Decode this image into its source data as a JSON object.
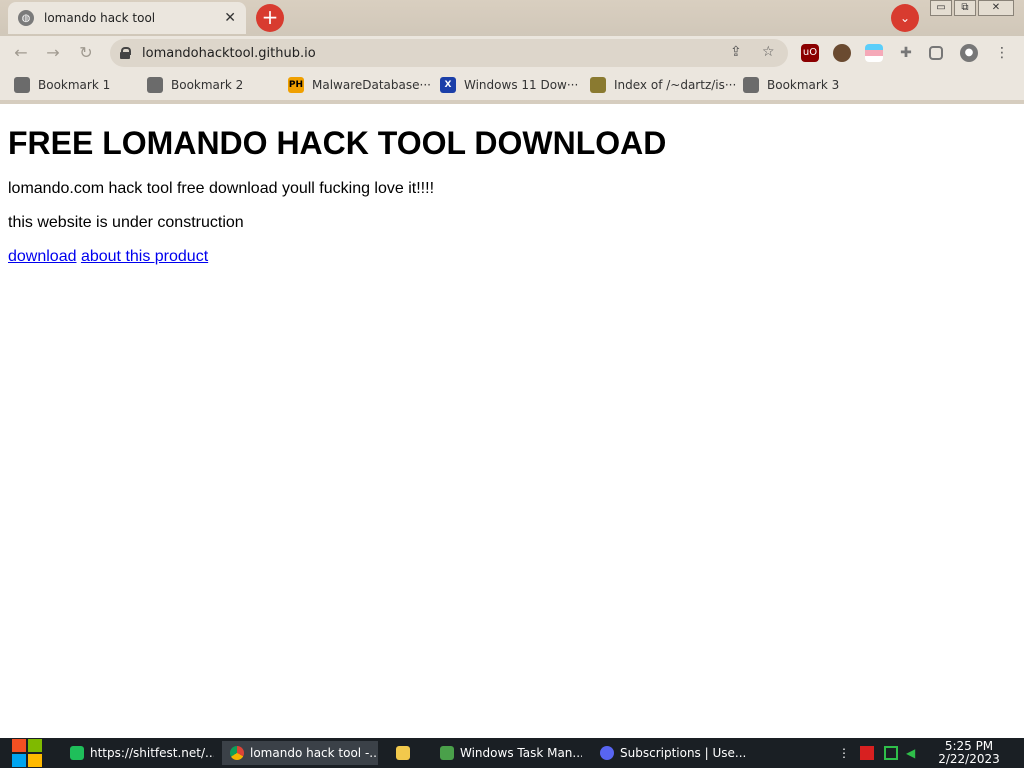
{
  "browser": {
    "tab": {
      "title": "lomando hack tool",
      "close_glyph": "✕"
    },
    "new_tab_glyph": "+",
    "tab_search_glyph": "⌄",
    "window_controls": [
      "▭",
      "⧉",
      "✕"
    ],
    "address": "lomandohacktool.github.io",
    "bookmarks": [
      {
        "label": "Bookmark 1",
        "icon": "placeholder-icon",
        "color": "#6b6b6b"
      },
      {
        "label": "Bookmark 2",
        "icon": "placeholder-icon",
        "color": "#6b6b6b"
      },
      {
        "label": "MalwareDatabase···",
        "icon": "ph-icon",
        "color": "#f0a000",
        "icon_text": "PH"
      },
      {
        "label": "Windows 11 Dow···",
        "icon": "x-icon",
        "color": "#1b3fa8",
        "icon_text": "X"
      },
      {
        "label": "Index of /~dartz/is···",
        "icon": "folder-icon",
        "color": "#8a7a30"
      },
      {
        "label": "Bookmark 3",
        "icon": "placeholder-icon",
        "color": "#6b6b6b"
      }
    ],
    "extensions": [
      "ublock-icon",
      "avatar-ext-icon",
      "flag-ext-icon",
      "puzzle-icon",
      "sidepanel-icon",
      "profile-icon",
      "menu-icon"
    ]
  },
  "page": {
    "heading": "FREE LOMANDO HACK TOOL DOWNLOAD",
    "paragraph1": "lomando.com hack tool free download youll fucking love it!!!!",
    "paragraph2": "this website is under construction",
    "links": {
      "download": "download",
      "about": "about this product"
    }
  },
  "taskbar": {
    "tasks": [
      {
        "label": "https://shitfest.net/...",
        "icon": "notes-icon",
        "color": "#1fbf5a",
        "active": false
      },
      {
        "label": "lomando hack tool -...",
        "icon": "chrome-icon",
        "color": "#e0a020",
        "active": true
      },
      {
        "label": "",
        "icon": "folder-icon",
        "color": "#f2c94c",
        "active": false
      },
      {
        "label": "Windows Task Man...",
        "icon": "task-manager-icon",
        "color": "#4aa04a",
        "active": false
      },
      {
        "label": "Subscriptions | Use...",
        "icon": "discord-icon",
        "color": "#5865f2",
        "active": false
      }
    ],
    "clock": {
      "time": "5:25 PM",
      "date": "2/22/2023"
    }
  }
}
